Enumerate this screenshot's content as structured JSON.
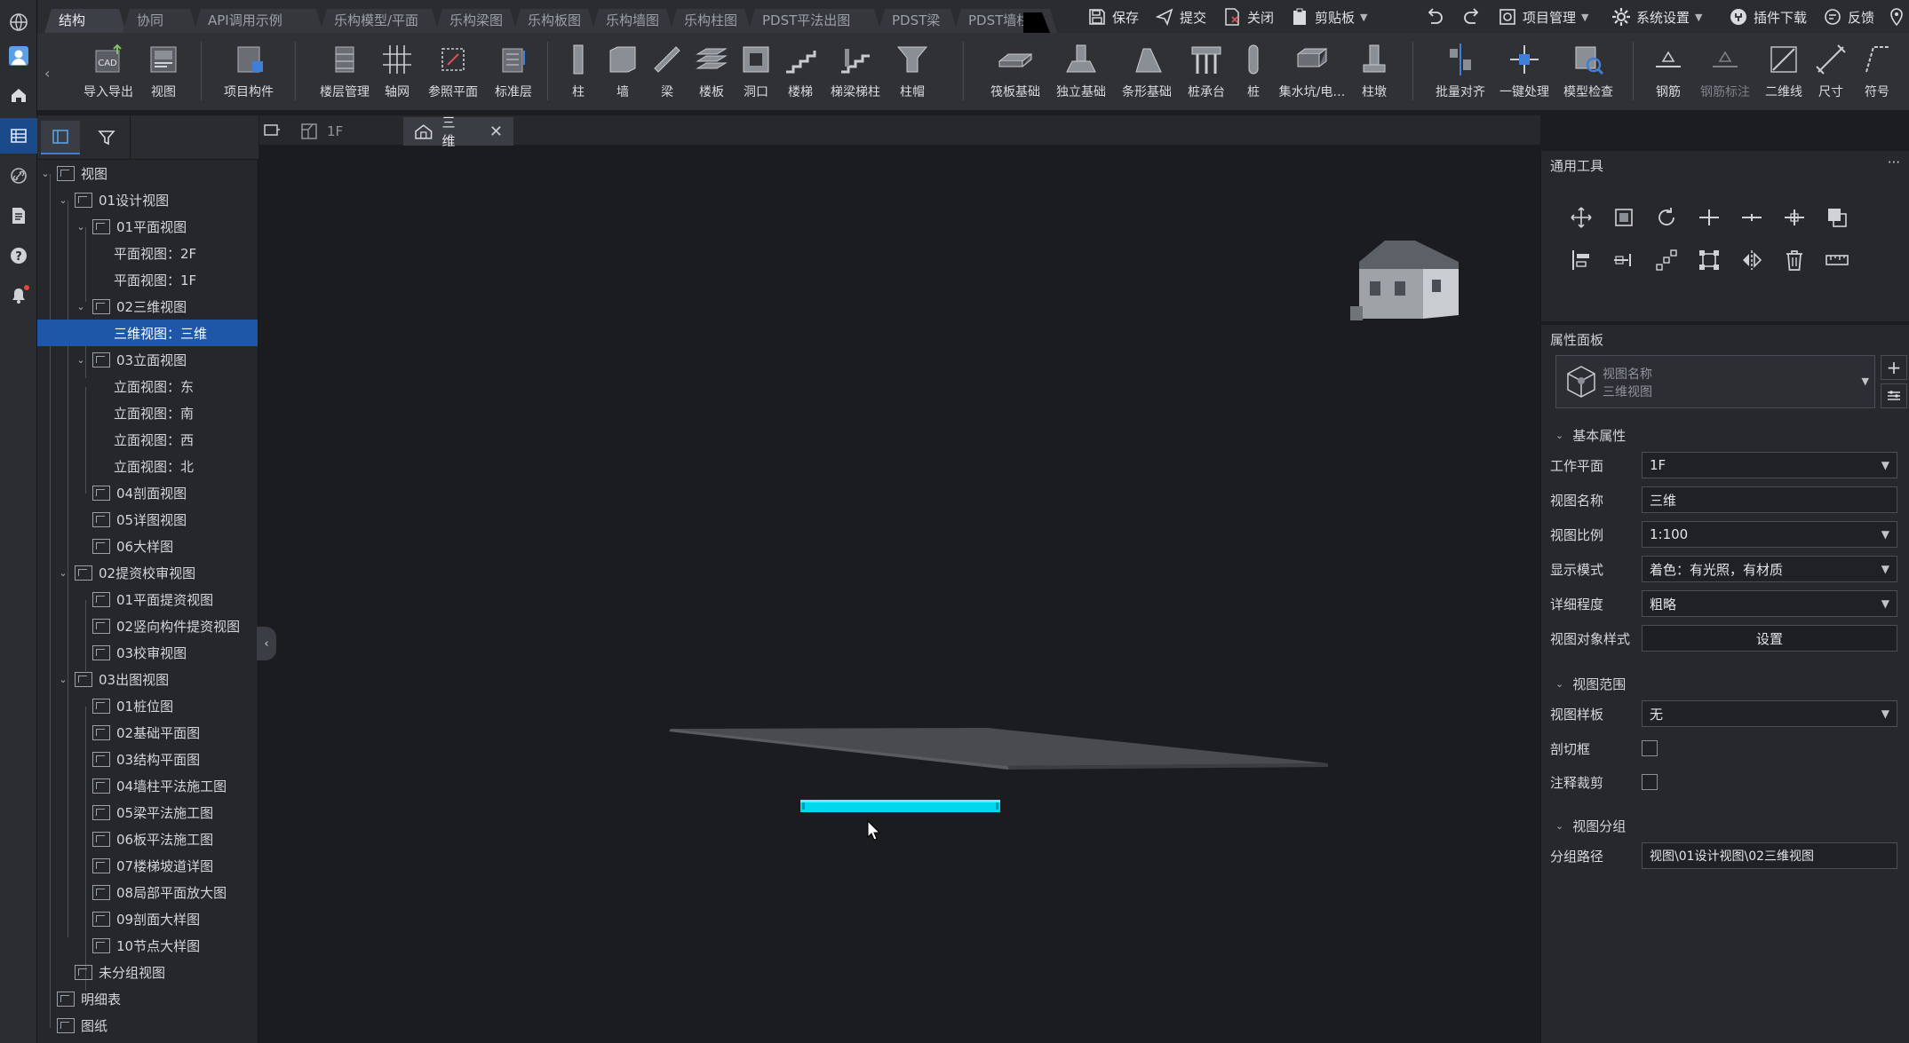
{
  "ribbon_tabs": [
    "结构",
    "协同",
    "API调用示例",
    "乐构模型/平面",
    "乐构梁图",
    "乐构板图",
    "乐构墙图",
    "乐构柱图",
    "PDST平法出图",
    "PDST梁",
    "PDST墙柱"
  ],
  "quick_actions": {
    "save": "保存",
    "submit": "提交",
    "close": "关闭",
    "clipboard": "剪贴板",
    "project_manage": "项目管理",
    "system_settings": "系统设置",
    "plugin_download": "插件下载",
    "feedback": "反馈",
    "help": "帮助"
  },
  "ribbon_buttons": {
    "import_export": "导入导出",
    "view": "视图",
    "project_component": "项目构件",
    "floor_manage": "楼层管理",
    "axis_grid": "轴网",
    "ref_plane": "参照平面",
    "standard_floor": "标准层",
    "column": "柱",
    "wall": "墙",
    "beam": "梁",
    "slab": "楼板",
    "opening": "洞口",
    "stair": "楼梯",
    "stair_beam_column": "梯梁梯柱",
    "column_cap": "柱帽",
    "raft_foundation": "筏板基础",
    "isolated_foundation": "独立基础",
    "strip_foundation": "条形基础",
    "pile_cap": "桩承台",
    "pile": "桩",
    "sump_pit": "集水坑/电…",
    "pier": "柱墩",
    "batch_align": "批量对齐",
    "one_click": "一键处理",
    "model_check": "模型检查",
    "rebar": "钢筋",
    "rebar_label": "钢筋标注",
    "line_2d": "二维线",
    "dimension": "尺寸",
    "symbol": "符号"
  },
  "tree": {
    "nodes": [
      {
        "label": "视图"
      },
      {
        "label": "01设计视图"
      },
      {
        "label": "01平面视图"
      },
      {
        "label": "平面视图：2F"
      },
      {
        "label": "平面视图：1F"
      },
      {
        "label": "02三维视图"
      },
      {
        "label": "三维视图：三维"
      },
      {
        "label": "03立面视图"
      },
      {
        "label": "立面视图：东"
      },
      {
        "label": "立面视图：南"
      },
      {
        "label": "立面视图：西"
      },
      {
        "label": "立面视图：北"
      },
      {
        "label": "04剖面视图"
      },
      {
        "label": "05详图视图"
      },
      {
        "label": "06大样图"
      },
      {
        "label": "02提资校审视图"
      },
      {
        "label": "01平面提资视图"
      },
      {
        "label": "02竖向构件提资视图"
      },
      {
        "label": "03校审视图"
      },
      {
        "label": "03出图视图"
      },
      {
        "label": "01桩位图"
      },
      {
        "label": "02基础平面图"
      },
      {
        "label": "03结构平面图"
      },
      {
        "label": "04墙柱平法施工图"
      },
      {
        "label": "05梁平法施工图"
      },
      {
        "label": "06板平法施工图"
      },
      {
        "label": "07楼梯坡道详图"
      },
      {
        "label": "08局部平面放大图"
      },
      {
        "label": "09剖面大样图"
      },
      {
        "label": "10节点大样图"
      },
      {
        "label": "未分组视图"
      },
      {
        "label": "明细表"
      },
      {
        "label": "图纸"
      }
    ]
  },
  "doc_tabs": [
    {
      "label": "1F"
    },
    {
      "label": "三维"
    }
  ],
  "tools_panel": {
    "title": "通用工具",
    "more": "···"
  },
  "properties": {
    "title": "属性面板",
    "type_name": "视图名称",
    "type_sub": "三维视图",
    "basic_section": "基本属性",
    "work_plane_label": "工作平面",
    "work_plane_value": "1F",
    "view_name_label": "视图名称",
    "view_name_value": "三维",
    "scale_label": "视图比例",
    "scale_value": "1:100",
    "display_mode_label": "显示模式",
    "display_mode_value": "着色：有光照，有材质",
    "detail_label": "详细程度",
    "detail_value": "粗略",
    "object_style_label": "视图对象样式",
    "object_style_button": "设置",
    "range_section": "视图范围",
    "template_label": "视图样板",
    "template_value": "无",
    "section_box_label": "剖切框",
    "annotation_crop_label": "注释裁剪",
    "group_section": "视图分组",
    "group_path_label": "分组路径",
    "group_path_value": "视图\\01设计视图\\02三维视图"
  },
  "colors": {
    "accent": "#1e57a8",
    "selection_highlight": "#00d8f0",
    "slab": "#4a4b4e",
    "background": "#1b1c1f"
  }
}
